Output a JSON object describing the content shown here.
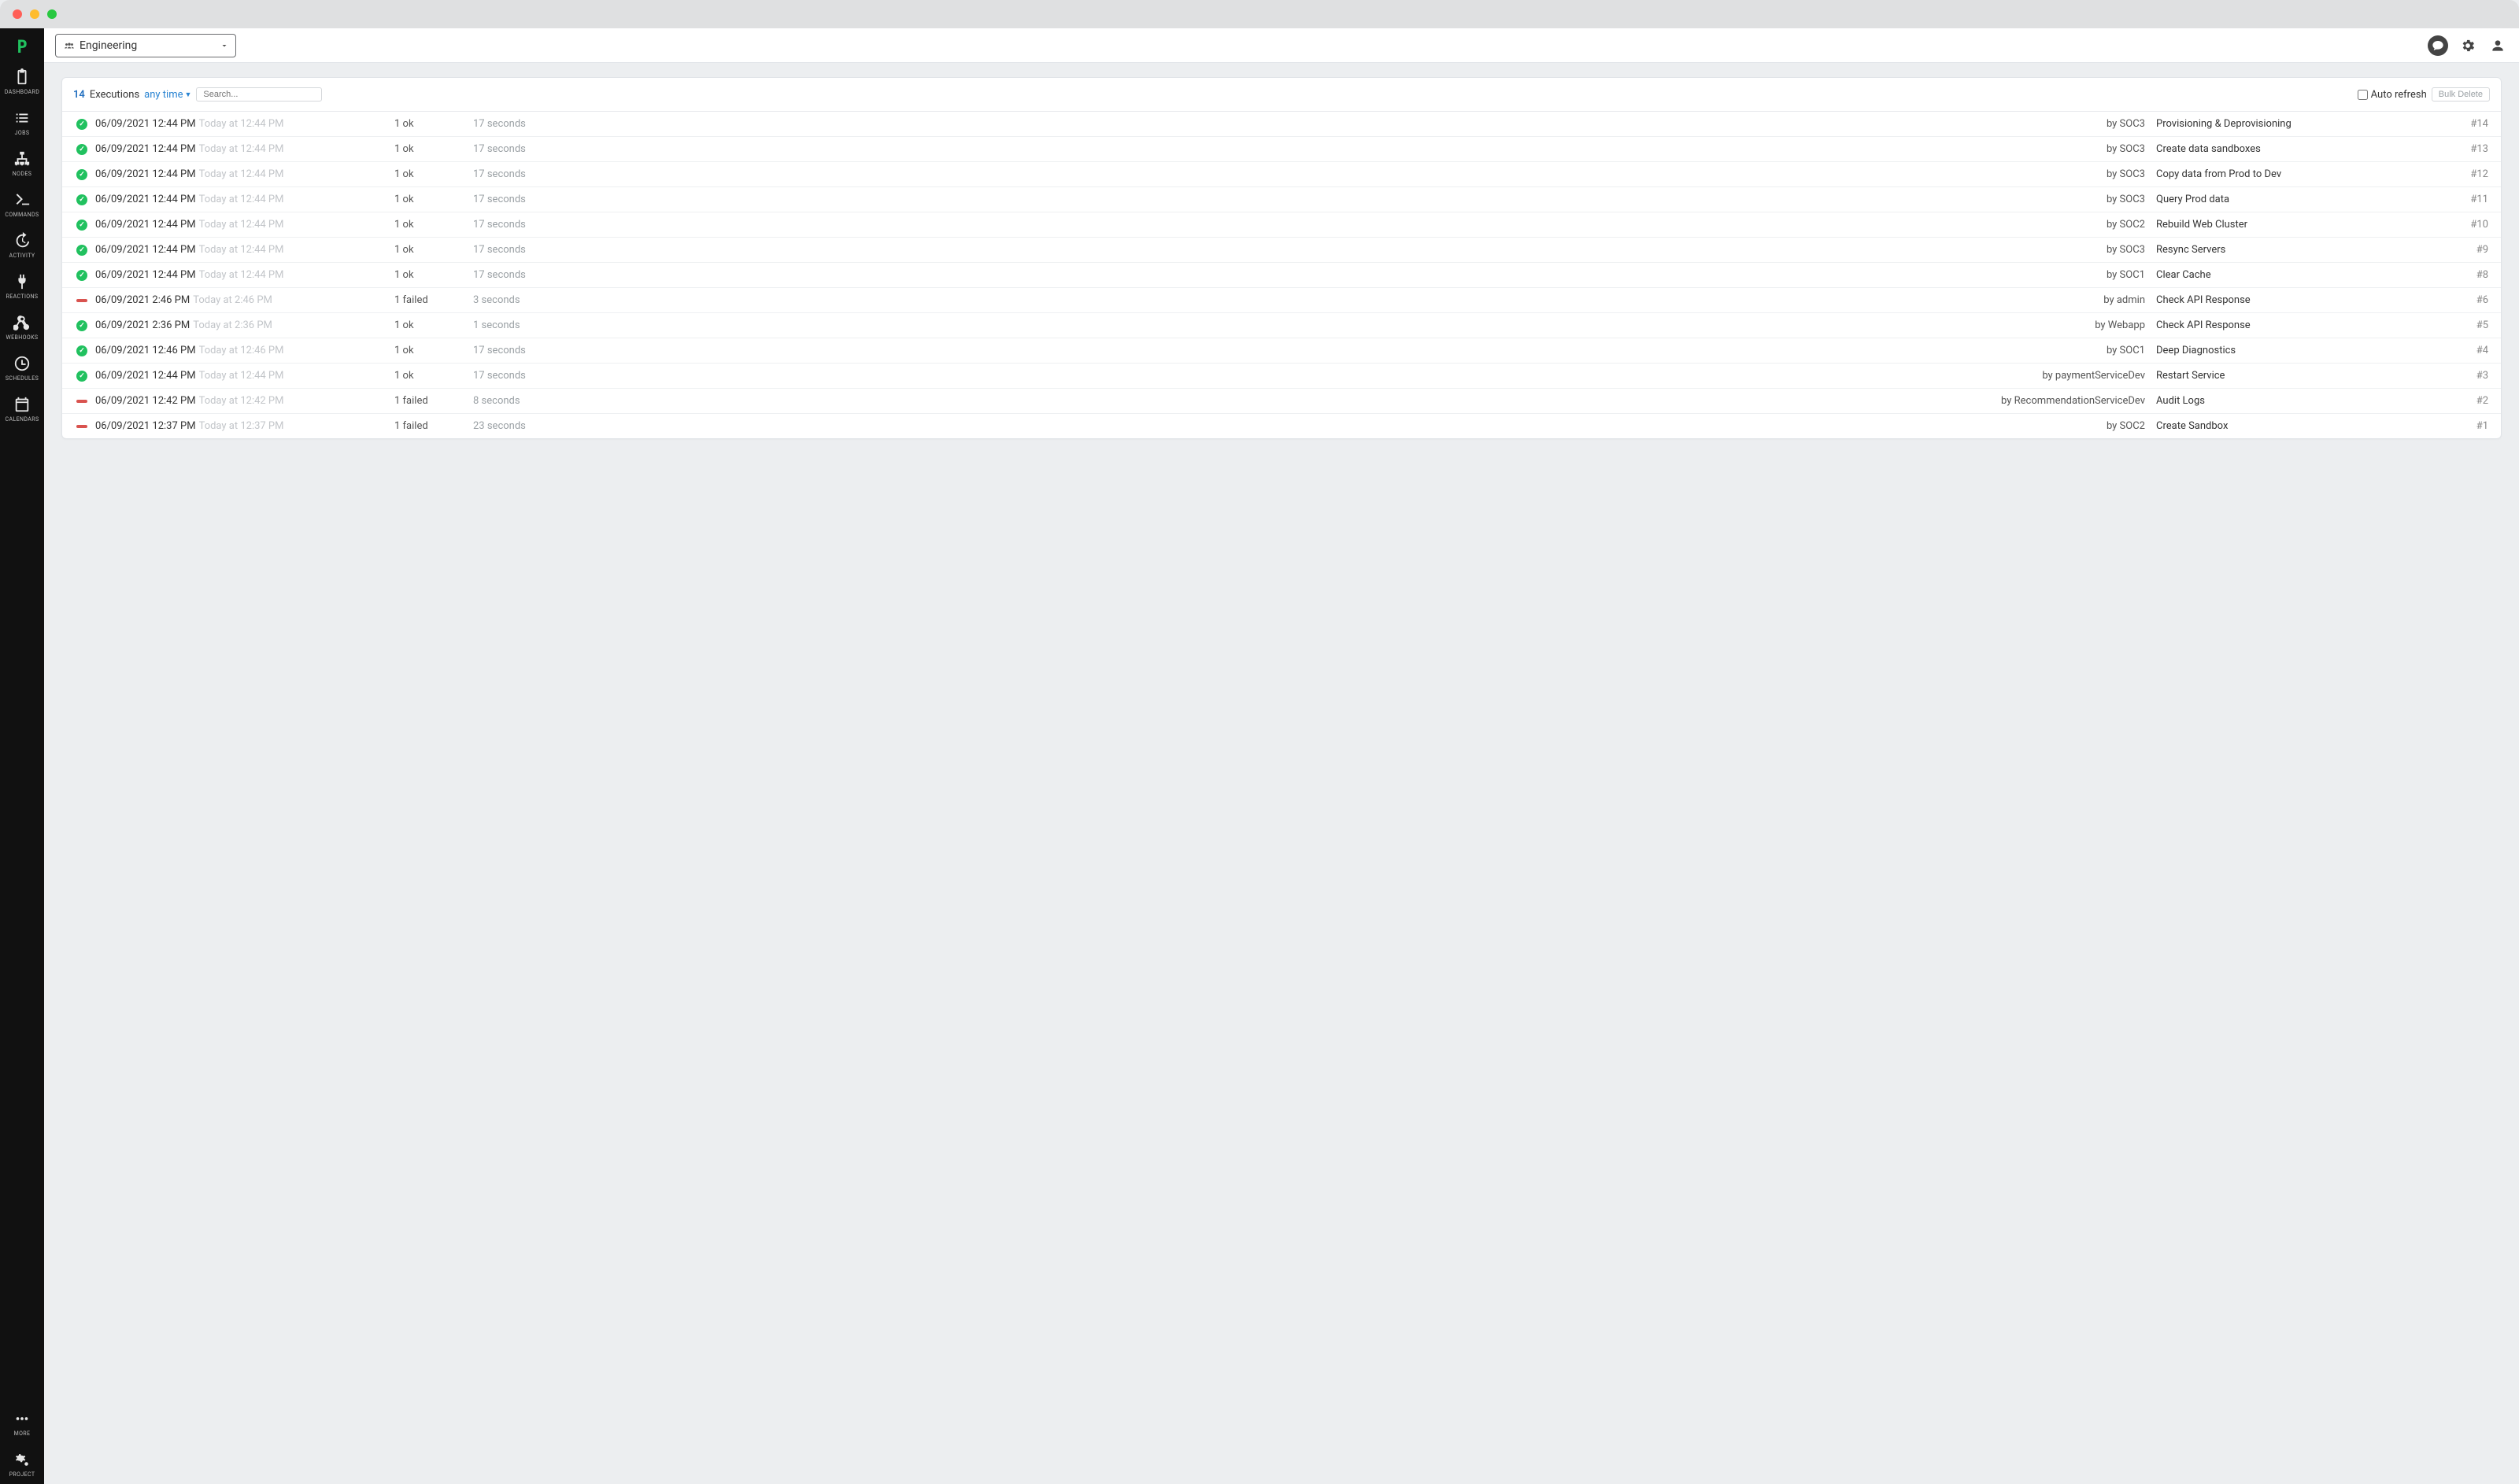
{
  "project_selector": {
    "label": "Engineering"
  },
  "sidebar": {
    "items": [
      {
        "label": "DASHBOARD"
      },
      {
        "label": "JOBS"
      },
      {
        "label": "NODES"
      },
      {
        "label": "COMMANDS"
      },
      {
        "label": "ACTIVITY"
      },
      {
        "label": "REACTIONS"
      },
      {
        "label": "WEBHOOKS"
      },
      {
        "label": "SCHEDULES"
      },
      {
        "label": "CALENDARS"
      }
    ],
    "bottom": [
      {
        "label": "MORE"
      },
      {
        "label": "PROJECT"
      }
    ]
  },
  "panel": {
    "count": "14",
    "count_word": "Executions",
    "any_time": "any time",
    "search_placeholder": "Search...",
    "auto_refresh_label": "Auto refresh",
    "bulk_delete_label": "Bulk Delete"
  },
  "executions": [
    {
      "status": "ok",
      "date": "06/09/2021 12:44 PM",
      "rel": "Today at 12:44 PM",
      "summary": "1 ok",
      "duration": "17 seconds",
      "by": "by SOC3",
      "job": "Provisioning & Deprovisioning",
      "num": "#14"
    },
    {
      "status": "ok",
      "date": "06/09/2021 12:44 PM",
      "rel": "Today at 12:44 PM",
      "summary": "1 ok",
      "duration": "17 seconds",
      "by": "by SOC3",
      "job": "Create data sandboxes",
      "num": "#13"
    },
    {
      "status": "ok",
      "date": "06/09/2021 12:44 PM",
      "rel": "Today at 12:44 PM",
      "summary": "1 ok",
      "duration": "17 seconds",
      "by": "by SOC3",
      "job": "Copy data from Prod to Dev",
      "num": "#12"
    },
    {
      "status": "ok",
      "date": "06/09/2021 12:44 PM",
      "rel": "Today at 12:44 PM",
      "summary": "1 ok",
      "duration": "17 seconds",
      "by": "by SOC3",
      "job": "Query Prod data",
      "num": "#11"
    },
    {
      "status": "ok",
      "date": "06/09/2021 12:44 PM",
      "rel": "Today at 12:44 PM",
      "summary": "1 ok",
      "duration": "17 seconds",
      "by": "by SOC2",
      "job": "Rebuild Web Cluster",
      "num": "#10"
    },
    {
      "status": "ok",
      "date": "06/09/2021 12:44 PM",
      "rel": "Today at 12:44 PM",
      "summary": "1 ok",
      "duration": "17 seconds",
      "by": "by SOC3",
      "job": "Resync Servers",
      "num": "#9"
    },
    {
      "status": "ok",
      "date": "06/09/2021 12:44 PM",
      "rel": "Today at 12:44 PM",
      "summary": "1 ok",
      "duration": "17 seconds",
      "by": "by SOC1",
      "job": "Clear Cache",
      "num": "#8"
    },
    {
      "status": "fail",
      "date": "06/09/2021 2:46 PM",
      "rel": "Today at 2:46 PM",
      "summary": "1 failed",
      "duration": "3 seconds",
      "by": "by admin",
      "job": "Check API Response",
      "num": "#6"
    },
    {
      "status": "ok",
      "date": "06/09/2021 2:36 PM",
      "rel": "Today at 2:36 PM",
      "summary": "1 ok",
      "duration": "1 seconds",
      "by": "by Webapp",
      "job": "Check API Response",
      "num": "#5"
    },
    {
      "status": "ok",
      "date": "06/09/2021 12:46 PM",
      "rel": "Today at 12:46 PM",
      "summary": "1 ok",
      "duration": "17 seconds",
      "by": "by SOC1",
      "job": "Deep Diagnostics",
      "num": "#4"
    },
    {
      "status": "ok",
      "date": "06/09/2021 12:44 PM",
      "rel": "Today at 12:44 PM",
      "summary": "1 ok",
      "duration": "17 seconds",
      "by": "by paymentServiceDev",
      "job": "Restart Service",
      "num": "#3"
    },
    {
      "status": "fail",
      "date": "06/09/2021 12:42 PM",
      "rel": "Today at 12:42 PM",
      "summary": "1 failed",
      "duration": "8 seconds",
      "by": "by RecommendationServiceDev",
      "job": "Audit Logs",
      "num": "#2"
    },
    {
      "status": "fail",
      "date": "06/09/2021 12:37 PM",
      "rel": "Today at 12:37 PM",
      "summary": "1 failed",
      "duration": "23 seconds",
      "by": "by SOC2",
      "job": "Create Sandbox",
      "num": "#1"
    }
  ]
}
